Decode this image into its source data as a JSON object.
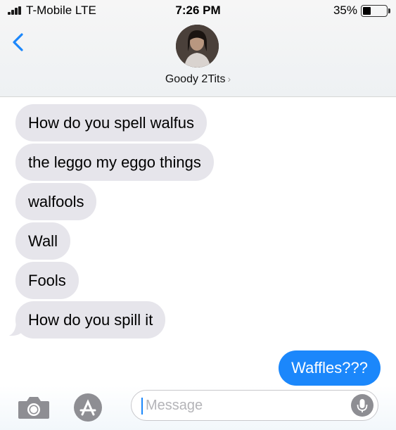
{
  "status_bar": {
    "carrier": "T-Mobile  LTE",
    "time": "7:26 PM",
    "battery_percent": "35%",
    "battery_level": 0.35
  },
  "header": {
    "contact_name": "Goody 2Tits",
    "chevron": "›"
  },
  "messages": {
    "received": [
      "How do you spell walfus",
      "the leggo my eggo things",
      "walfools",
      "Wall",
      "Fools",
      "How do you spill it"
    ],
    "sent": [
      "Waffles???"
    ]
  },
  "input": {
    "placeholder": "Message"
  },
  "icons": {
    "signal": "signal-bars-icon",
    "back": "chevron-left-icon",
    "camera": "camera-icon",
    "apps": "app-store-icon",
    "mic": "microphone-icon"
  },
  "colors": {
    "sent_bubble": "#1b87fb",
    "received_bubble": "#e6e5eb",
    "accent": "#1b87fb"
  }
}
